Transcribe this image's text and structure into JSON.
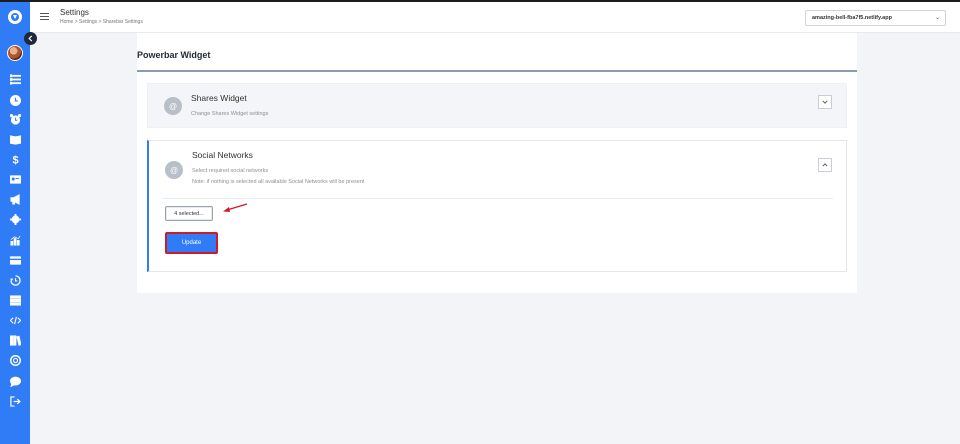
{
  "header": {
    "title": "Settings",
    "breadcrumb": "Home  >  Settings  >  Sharebar Settings",
    "site_select": "amazing-bell-fba7f5.netlify.app"
  },
  "sidebar": {
    "items": [
      "list-icon",
      "clock-icon",
      "alarm-icon",
      "book-icon",
      "dollar-icon",
      "id-card-icon",
      "megaphone-icon",
      "gear-icon",
      "chart-icon",
      "card-icon",
      "history-icon",
      "table-icon",
      "code-icon",
      "library-icon",
      "support-icon",
      "chat-icon",
      "logout-icon"
    ]
  },
  "card": {
    "title": "Powerbar Widget"
  },
  "shares_widget": {
    "icon_glyph": "@",
    "heading": "Shares Widget",
    "subtitle": "Change Shares Widget settings"
  },
  "social_widget": {
    "icon_glyph": "@",
    "heading": "Social Networks",
    "subtitle_1": "Select required social networks",
    "subtitle_2": "Note: if nothing is selected all available Social Networks will be present",
    "multiselect_value": "4 selected...",
    "update_label": "Update"
  },
  "colors": {
    "sidebar": "#2f7cf6",
    "accent": "#2f7cf6",
    "highlight_border": "#d0192a",
    "annotation_arrow": "#d0192a"
  }
}
